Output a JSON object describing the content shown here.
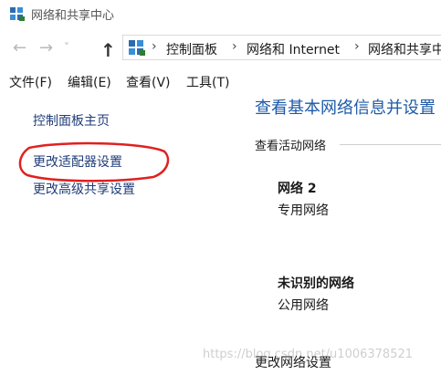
{
  "window": {
    "title": "网络和共享中心",
    "icon": "network-center-icon"
  },
  "navigation": {
    "back_icon": "arrow-left-icon",
    "forward_icon": "arrow-right-icon",
    "recent_icon": "chevron-down-icon",
    "up_icon": "arrow-up-icon",
    "breadcrumbs": [
      "控制面板",
      "网络和 Internet",
      "网络和共享中"
    ],
    "separator": "›"
  },
  "menu": {
    "items": [
      "文件(F)",
      "编辑(E)",
      "查看(V)",
      "工具(T)"
    ]
  },
  "sidebar": {
    "links": [
      "控制面板主页",
      "更改适配器设置",
      "更改高级共享设置"
    ],
    "highlight_color": "#e02020"
  },
  "main": {
    "title": "查看基本网络信息并设置",
    "active_networks_heading": "查看活动网络",
    "networks": [
      {
        "name": "网络 2",
        "type": "专用网络"
      },
      {
        "name": "未识别的网络",
        "type": "公用网络"
      }
    ],
    "change_settings_heading": "更改网络设置"
  },
  "watermark": "https://blog.csdn.net/u1006378521",
  "colors": {
    "link": "#1f3d7a",
    "title": "#1e5aa8"
  }
}
